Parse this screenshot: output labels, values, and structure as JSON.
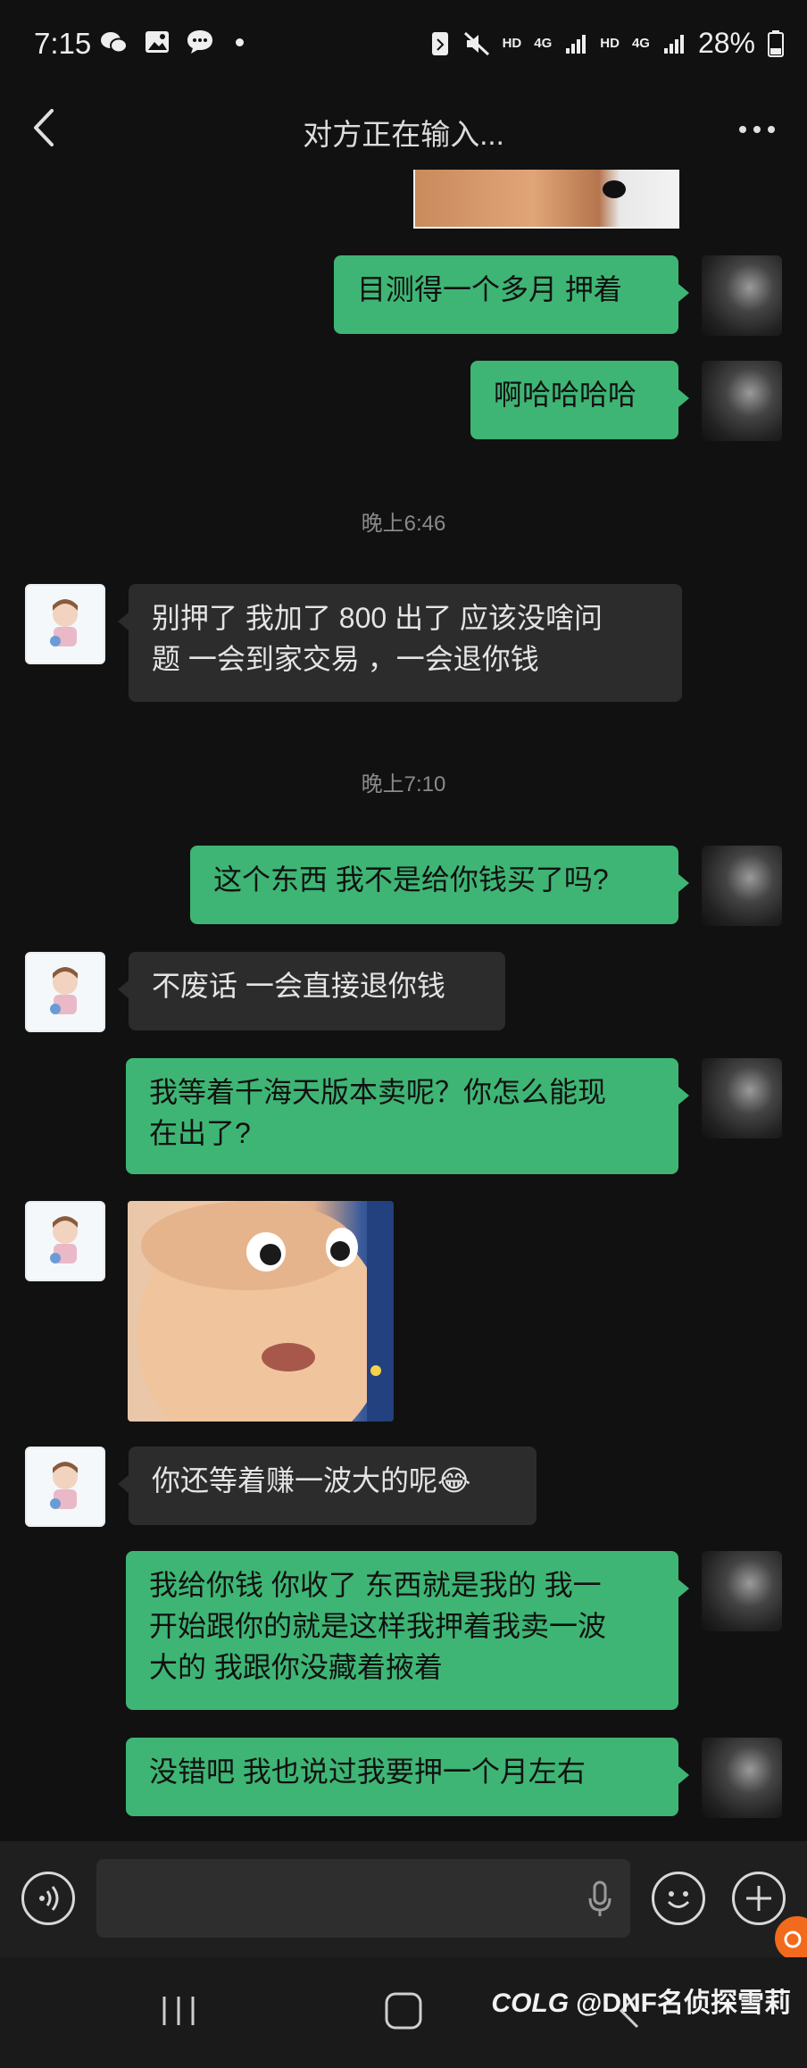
{
  "status_bar": {
    "time": "7:15",
    "network_labels": [
      "HD",
      "4G",
      "HD",
      "4G"
    ],
    "battery": "28%"
  },
  "header": {
    "title": "对方正在输入..."
  },
  "messages": [
    {
      "type": "timestamp",
      "text": "晚上6:46"
    },
    {
      "type": "timestamp",
      "text": "晚上7:10"
    }
  ],
  "chat": {
    "m1": "目测得一个多月 押着",
    "m2": "啊哈哈哈哈",
    "ts1": "晚上6:46",
    "m3_line1": "别押了  我加了 800 出了  应该没啥问",
    "m3_line2": "题 一会到家交易  ，一会退你钱",
    "ts2": "晚上7:10",
    "m4": "这个东西 我不是给你钱买了吗?",
    "m5": "不废话 一会直接退你钱",
    "m6_line1": "我等着千海天版本卖呢？你怎么能现",
    "m6_line2": "在出了?",
    "m7": "你还等着赚一波大的呢",
    "m7_emoji": "😂",
    "m8_line1": "我给你钱 你收了 东西就是我的 我一",
    "m8_line2": "开始跟你的就是这样我押着我卖一波",
    "m8_line3": "大的 我跟你没藏着掖着",
    "m9": "没错吧 我也说过我要押一个月左右"
  },
  "watermark": "@DNF名侦探雪莉",
  "watermark_logo": "COLG",
  "icons": [
    "back-icon",
    "more-icon",
    "voice-icon",
    "mic-icon",
    "emoji-icon",
    "plus-icon"
  ],
  "colors": {
    "sent_bubble": "#3eb574",
    "received_bubble": "#2c2c2c",
    "background": "#111111"
  }
}
